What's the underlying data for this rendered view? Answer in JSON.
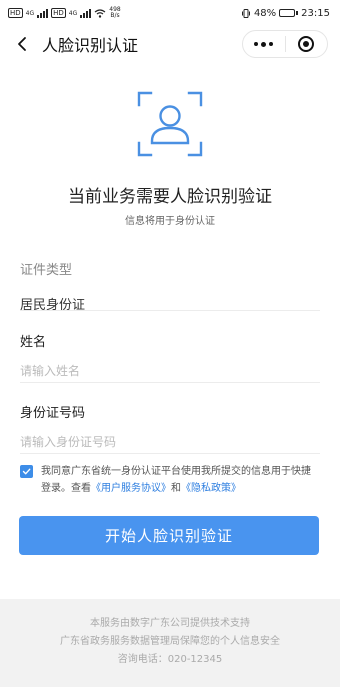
{
  "status_bar": {
    "sim1": "HD",
    "sim2": "HD",
    "net1": "4G",
    "net2": "4G",
    "speed_value": "498",
    "speed_unit": "B/s",
    "battery_percent": "48%",
    "battery_level": 0.48,
    "time": "23:15"
  },
  "nav": {
    "title": "人脸识别认证"
  },
  "header": {
    "title": "当前业务需要人脸识别验证",
    "subtitle": "信息将用于身份认证"
  },
  "form": {
    "id_type": {
      "label": "证件类型",
      "value": "居民身份证"
    },
    "name": {
      "label": "姓名",
      "placeholder": "请输入姓名",
      "value": ""
    },
    "id_number": {
      "label": "身份证号码",
      "placeholder": "请输入身份证号码",
      "value": ""
    }
  },
  "agreement": {
    "checked": true,
    "text_part1": "我同意广东省统一身份认证平台使用我所提交的信息用于快捷登录。查看",
    "link_user": "《用户服务协议》",
    "and": "和",
    "link_privacy": "《隐私政策》"
  },
  "start_button": {
    "label": "开始人脸识别验证"
  },
  "footer": {
    "line1": "本服务由数字广东公司提供技术支持",
    "line2": "广东省政务服务数据管理局保障您的个人信息安全",
    "line3": "咨询电话：020-12345"
  },
  "colors": {
    "accent": "#4994ef",
    "link": "#2f7fe0"
  }
}
